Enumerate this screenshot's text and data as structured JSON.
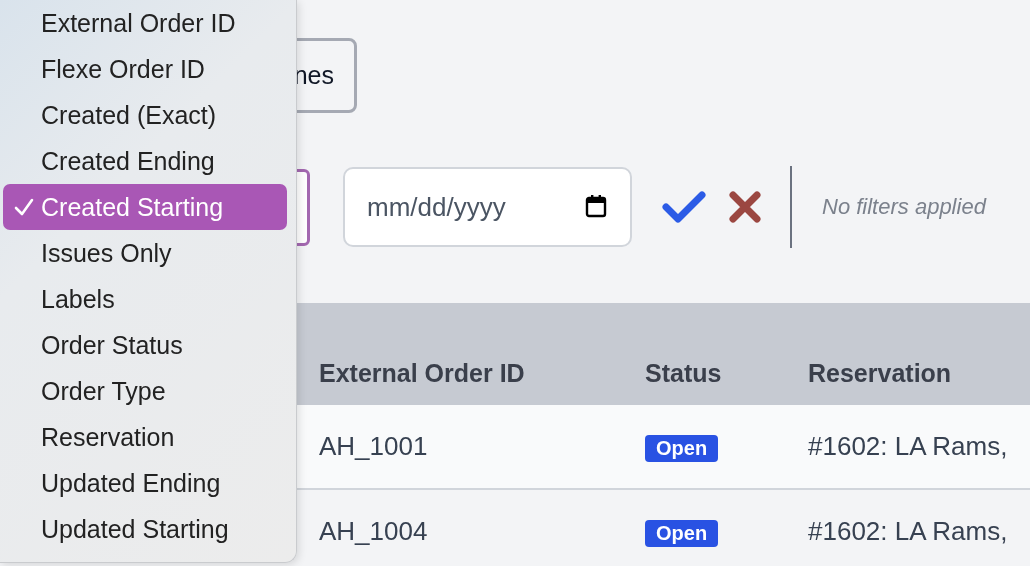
{
  "toolbar": {
    "button_partial": "nes"
  },
  "filter_bar": {
    "date_placeholder": "mm/dd/yyyy",
    "status": "No filters applied"
  },
  "table": {
    "columns": [
      "External Order ID",
      "Status",
      "Reservation"
    ],
    "rows": [
      {
        "external_order_id": "AH_1001",
        "status": "Open",
        "reservation": "#1602: LA Rams,"
      },
      {
        "external_order_id": "AH_1004",
        "status": "Open",
        "reservation": "#1602: LA Rams,"
      }
    ]
  },
  "filter_menu": {
    "items": [
      {
        "label": "External Order ID",
        "selected": false
      },
      {
        "label": "Flexe Order ID",
        "selected": false
      },
      {
        "label": "Created (Exact)",
        "selected": false
      },
      {
        "label": "Created Ending",
        "selected": false
      },
      {
        "label": "Created Starting",
        "selected": true
      },
      {
        "label": "Issues Only",
        "selected": false
      },
      {
        "label": "Labels",
        "selected": false
      },
      {
        "label": "Order Status",
        "selected": false
      },
      {
        "label": "Order Type",
        "selected": false
      },
      {
        "label": "Reservation",
        "selected": false
      },
      {
        "label": "Updated Ending",
        "selected": false
      },
      {
        "label": "Updated Starting",
        "selected": false
      }
    ]
  }
}
